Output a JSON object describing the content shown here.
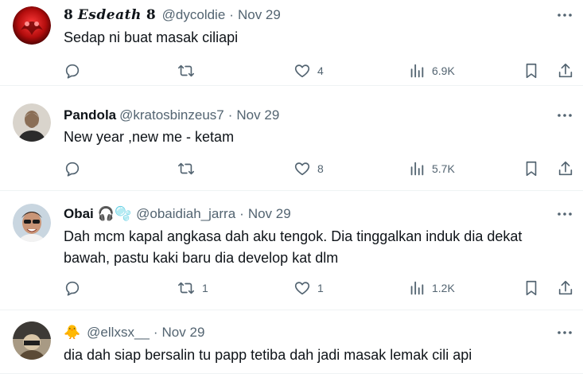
{
  "tweets": [
    {
      "display_name": "ꉓ 𝑬𝒔𝒅𝒆𝒂𝒕𝒉 ꉓ",
      "name_prefix": "8",
      "name_main": "Esdeath",
      "name_suffix": "8",
      "handle": "@dycoldie",
      "date": "Nov 29",
      "text": "Sedap ni buat masak ciliapi",
      "replies": "",
      "retweets": "",
      "likes": "4",
      "views": "6.9K"
    },
    {
      "display_name": "Pandola",
      "handle": "@kratosbinzeus7",
      "date": "Nov 29",
      "text": "New year ,new me - ketam",
      "replies": "",
      "retweets": "",
      "likes": "8",
      "views": "5.7K"
    },
    {
      "display_name": "Obai",
      "emoji": "🎧🫧",
      "handle": "@obaidiah_jarra",
      "date": "Nov 29",
      "text": "Dah mcm kapal angkasa dah aku tengok. Dia tinggalkan induk dia dekat bawah, pastu kaki baru dia develop kat dlm",
      "replies": "",
      "retweets": "1",
      "likes": "1",
      "views": "1.2K"
    },
    {
      "display_name": "🐥",
      "handle": "@ellxsx__",
      "date": "Nov 29",
      "text": "dia dah siap bersalin tu papp tetiba dah jadi masak lemak cili api"
    }
  ],
  "separator": "·",
  "colors": {
    "text_primary": "#0f1419",
    "text_secondary": "#536471",
    "divider": "#eff3f4"
  }
}
